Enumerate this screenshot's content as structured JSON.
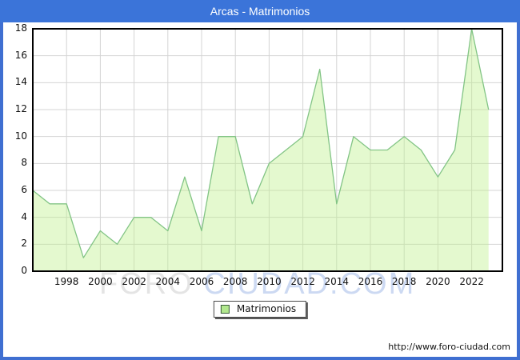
{
  "window": {
    "title": "Arcas - Matrimonios"
  },
  "legend": {
    "label": "Matrimonios"
  },
  "watermark": {
    "part1": "FORO",
    "part2": "CIUDAD.COM"
  },
  "footer": {
    "url": "http://www.foro-ciudad.com"
  },
  "colors": {
    "titlebar_blue": "#3b74d9",
    "frame_blue": "#3f6fd1",
    "area_fill": "rgba(190,240,140,0.42)",
    "line_green": "#82c485",
    "swatch_green": "#b2e88e",
    "gridline": "#d4d4d4",
    "plot_border": "#000000",
    "watermark_gray": "#e4e4e4",
    "watermark_blue": "#ccd9f2"
  },
  "chart_data": {
    "type": "area",
    "title": "Arcas - Matrimonios",
    "series_name": "Matrimonios",
    "x": [
      1996,
      1997,
      1998,
      1999,
      2000,
      2001,
      2002,
      2003,
      2004,
      2005,
      2006,
      2007,
      2008,
      2009,
      2010,
      2011,
      2012,
      2013,
      2014,
      2015,
      2016,
      2017,
      2018,
      2019,
      2020,
      2021,
      2022,
      2023
    ],
    "values": [
      6,
      5,
      5,
      1,
      3,
      2,
      4,
      4,
      3,
      7,
      3,
      10,
      10,
      5,
      8,
      9,
      10,
      15,
      5,
      10,
      9,
      9,
      10,
      9,
      7,
      9,
      18,
      12
    ],
    "xticks": [
      1998,
      2000,
      2002,
      2004,
      2006,
      2008,
      2010,
      2012,
      2014,
      2016,
      2018,
      2020,
      2022
    ],
    "yticks": [
      0,
      2,
      4,
      6,
      8,
      10,
      12,
      14,
      16,
      18
    ],
    "ylim": [
      0,
      18
    ],
    "xlabel": "",
    "ylabel": "",
    "grid": true,
    "legend_position": "bottom-center"
  }
}
